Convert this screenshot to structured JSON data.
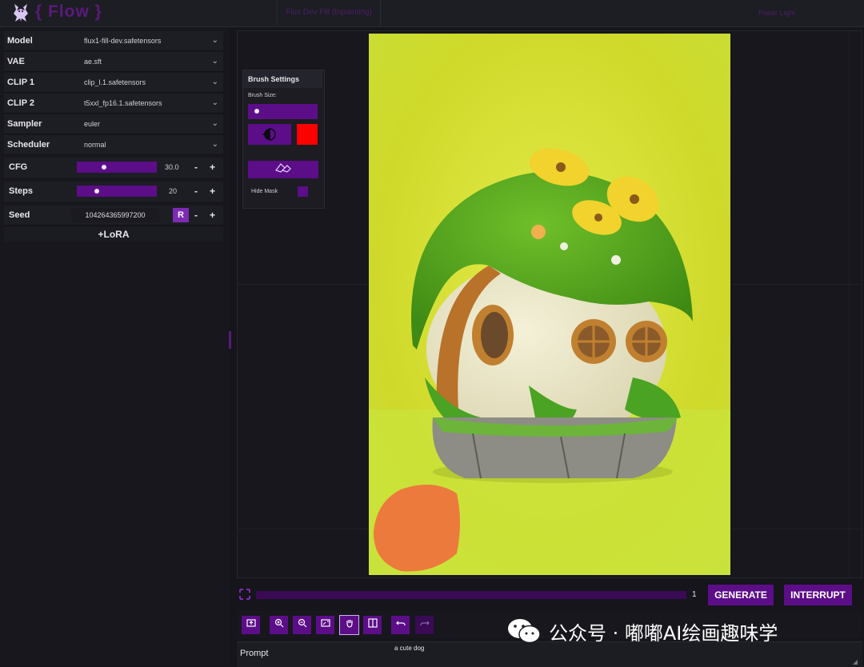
{
  "header": {
    "logo_text": "{ Flow }",
    "workflow_name": "Flux Dev Fill (Inpainting)",
    "theme_name": "Paper Light"
  },
  "settings": {
    "model": {
      "label": "Model",
      "value": "flux1-fill-dev.safetensors"
    },
    "vae": {
      "label": "VAE",
      "value": "ae.sft"
    },
    "clip1": {
      "label": "CLIP 1",
      "value": "clip_l.1.safetensors"
    },
    "clip2": {
      "label": "CLIP 2",
      "value": "t5xxl_fp16.1.safetensors"
    },
    "sampler": {
      "label": "Sampler",
      "value": "euler"
    },
    "scheduler": {
      "label": "Scheduler",
      "value": "normal"
    },
    "cfg": {
      "label": "CFG",
      "value": "30.0",
      "fraction": 0.33
    },
    "steps": {
      "label": "Steps",
      "value": "20",
      "fraction": 0.23
    },
    "seed": {
      "label": "Seed",
      "value": "104264365997200",
      "random_label": "R"
    },
    "minus": "-",
    "plus": "+",
    "lora_button": "+LoRA",
    "dropdown_icon": "chevron-down-icon"
  },
  "brush": {
    "title": "Brush Settings",
    "size_label": "Brush Size:",
    "size_fraction": 0.1,
    "color": "#ff0000",
    "hide_mask_label": "Hide Mask"
  },
  "progress": {
    "fraction": 0,
    "count": "1",
    "generate_label": "GENERATE",
    "interrupt_label": "INTERRUPT"
  },
  "toolbar": {
    "icons": [
      "upload-icon",
      "zoom-in-icon",
      "zoom-out-icon",
      "fit-screen-icon",
      "pan-hand-icon",
      "compare-icon",
      "undo-icon",
      "redo-icon"
    ]
  },
  "prompt": {
    "label": "Prompt",
    "value": "a cute dog"
  },
  "watermark": {
    "text": "公众号 · 嘟嘟AI绘画趣味学"
  },
  "colors": {
    "accent": "#5c0d88",
    "accent_dark": "#3a0a55",
    "background": "#15151b",
    "mask": "#ff0000"
  }
}
